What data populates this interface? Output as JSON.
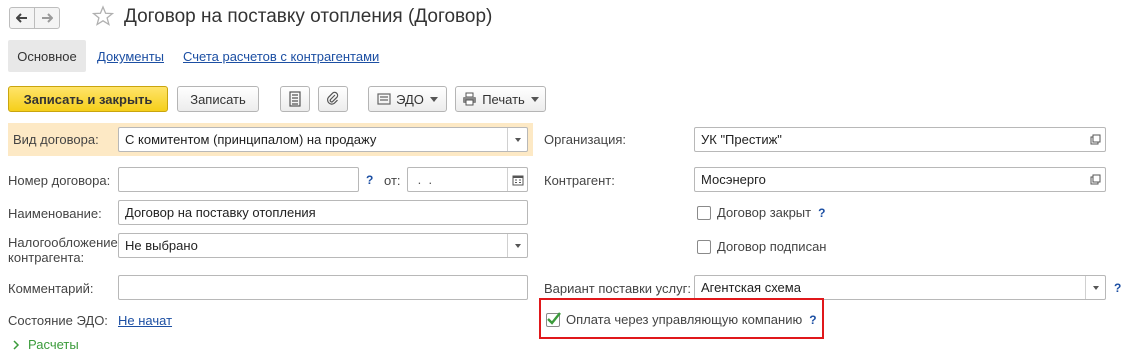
{
  "window": {
    "title": "Договор на поставку отопления (Договор)",
    "nav_back_icon": "arrow-left-icon",
    "nav_forward_icon": "arrow-right-icon",
    "favorite_icon": "star-icon"
  },
  "tabs": [
    {
      "label": "Основное",
      "active": true
    },
    {
      "label": "Документы",
      "active": false
    },
    {
      "label": "Счета расчетов с контрагентами",
      "active": false
    }
  ],
  "toolbar": {
    "save_close_label": "Записать и закрыть",
    "save_label": "Записать",
    "edo_label": "ЭДО",
    "print_label": "Печать",
    "list_icon": "document-list-icon",
    "attach_icon": "paperclip-icon"
  },
  "form": {
    "contract_type": {
      "label": "Вид договора:",
      "value": "С комитентом (принципалом) на продажу"
    },
    "contract_number": {
      "label": "Номер договора:",
      "value": "",
      "help": "?",
      "date_label": "от:",
      "date_value": " .  . "
    },
    "name": {
      "label": "Наименование:",
      "value": "Договор на поставку отопления"
    },
    "taxation": {
      "label": "Налогообложение контрагента:",
      "value": "Не выбрано"
    },
    "comment": {
      "label": "Комментарий:",
      "value": ""
    },
    "edo_state": {
      "label": "Состояние ЭДО:",
      "value": "Не начат"
    },
    "organization": {
      "label": "Организация:",
      "value": "УК \"Престиж\""
    },
    "counterparty": {
      "label": "Контрагент:",
      "value": "Мосэнерго"
    },
    "contract_closed": {
      "label": "Договор закрыт",
      "checked": false,
      "help": "?"
    },
    "contract_signed": {
      "label": "Договор подписан",
      "checked": false
    },
    "service_variant": {
      "label": "Вариант поставки услуг:",
      "value": "Агентская схема",
      "help": "?"
    },
    "payment_via_mc": {
      "label": "Оплата через управляющую компанию",
      "checked": true,
      "help": "?"
    },
    "settlements_section": {
      "label": "Расчеты"
    }
  },
  "colors": {
    "primary_button": "#f5cf1a",
    "highlight_row": "#fde9c5",
    "link": "#1c4fa3",
    "annotation_box": "#e0181b",
    "check_mark": "#3b9b3b"
  }
}
